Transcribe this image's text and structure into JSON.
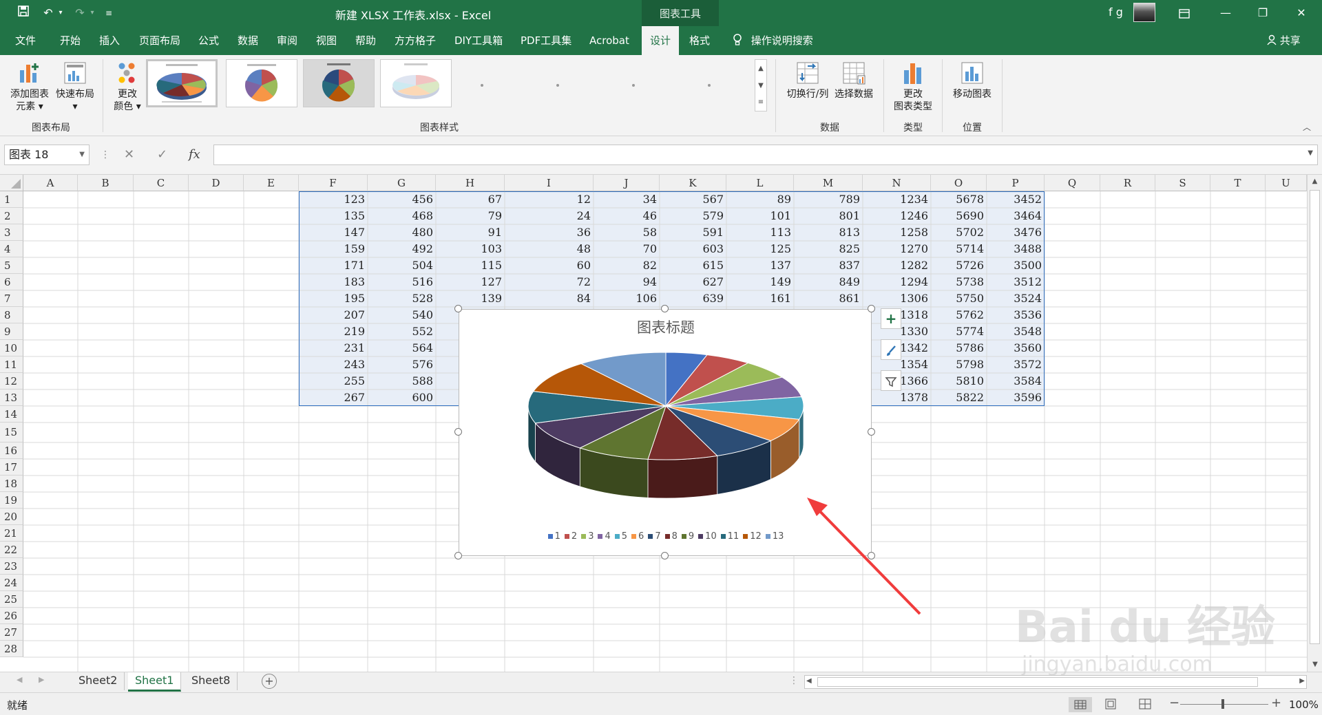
{
  "window": {
    "title": "新建 XLSX 工作表.xlsx  -  Excel",
    "context_tab_title": "图表工具",
    "user": "f g"
  },
  "menu": {
    "tabs": [
      "文件",
      "开始",
      "插入",
      "页面布局",
      "公式",
      "数据",
      "审阅",
      "视图",
      "帮助",
      "方方格子",
      "DIY工具箱",
      "PDF工具集",
      "Acrobat",
      "设计",
      "格式"
    ],
    "active_tab": "设计",
    "tell_me": "操作说明搜索",
    "share": "共享"
  },
  "ribbon": {
    "add_element": [
      "添加图表",
      "元素 ▾"
    ],
    "quick_layout": [
      "快速布局",
      "▾"
    ],
    "change_color": [
      "更改",
      "颜色 ▾"
    ],
    "switch_rowcol": "切换行/列",
    "select_data": "选择数据",
    "change_type": [
      "更改",
      "图表类型"
    ],
    "move_chart": "移动图表",
    "groups": {
      "layout": "图表布局",
      "styles": "图表样式",
      "data": "数据",
      "type": "类型",
      "location": "位置"
    }
  },
  "formula_bar": {
    "name_box": "图表 18",
    "fx": "fx",
    "value": ""
  },
  "sheet": {
    "columns": [
      "A",
      "B",
      "C",
      "D",
      "E",
      "F",
      "G",
      "H",
      "I",
      "J",
      "K",
      "L",
      "M",
      "N",
      "O",
      "P",
      "Q",
      "R",
      "S",
      "T",
      "U"
    ],
    "rows": [
      [
        "123",
        "456",
        "67",
        "12",
        "34",
        "567",
        "89",
        "789",
        "1234",
        "5678",
        "3452"
      ],
      [
        "135",
        "468",
        "79",
        "24",
        "46",
        "579",
        "101",
        "801",
        "1246",
        "5690",
        "3464"
      ],
      [
        "147",
        "480",
        "91",
        "36",
        "58",
        "591",
        "113",
        "813",
        "1258",
        "5702",
        "3476"
      ],
      [
        "159",
        "492",
        "103",
        "48",
        "70",
        "603",
        "125",
        "825",
        "1270",
        "5714",
        "3488"
      ],
      [
        "171",
        "504",
        "115",
        "60",
        "82",
        "615",
        "137",
        "837",
        "1282",
        "5726",
        "3500"
      ],
      [
        "183",
        "516",
        "127",
        "72",
        "94",
        "627",
        "149",
        "849",
        "1294",
        "5738",
        "3512"
      ],
      [
        "195",
        "528",
        "139",
        "84",
        "106",
        "639",
        "161",
        "861",
        "1306",
        "5750",
        "3524"
      ],
      [
        "207",
        "540",
        "",
        "",
        "",
        "",
        "",
        "",
        "1318",
        "5762",
        "3536"
      ],
      [
        "219",
        "552",
        "",
        "",
        "",
        "",
        "",
        "",
        "1330",
        "5774",
        "3548"
      ],
      [
        "231",
        "564",
        "",
        "",
        "",
        "",
        "",
        "",
        "1342",
        "5786",
        "3560"
      ],
      [
        "243",
        "576",
        "",
        "",
        "",
        "",
        "",
        "",
        "1354",
        "5798",
        "3572"
      ],
      [
        "255",
        "588",
        "",
        "",
        "",
        "",
        "",
        "",
        "1366",
        "5810",
        "3584"
      ],
      [
        "267",
        "600",
        "",
        "",
        "",
        "",
        "",
        "",
        "1378",
        "5822",
        "3596"
      ]
    ],
    "row_numbers": [
      "1",
      "2",
      "3",
      "4",
      "5",
      "6",
      "7",
      "8",
      "9",
      "10",
      "11",
      "12",
      "13",
      "14",
      "15",
      "16",
      "17",
      "18",
      "19",
      "20",
      "21",
      "22",
      "23",
      "24",
      "25",
      "26",
      "27",
      "28"
    ]
  },
  "chart_data": {
    "type": "pie",
    "title": "图表标题",
    "categories": [
      "1",
      "2",
      "3",
      "4",
      "5",
      "6",
      "7",
      "8",
      "9",
      "10",
      "11",
      "12",
      "13"
    ],
    "values": [
      123,
      135,
      147,
      159,
      171,
      183,
      195,
      207,
      219,
      231,
      243,
      255,
      267
    ],
    "colors": [
      "#4472c4",
      "#c0504d",
      "#9bbb59",
      "#8064a2",
      "#4bacc6",
      "#f79646",
      "#2c4d75",
      "#772c2a",
      "#5f7530",
      "#4d3b62",
      "#276a7c",
      "#b65708",
      "#729aca"
    ],
    "legend_position": "bottom"
  },
  "sheet_tabs": {
    "tabs": [
      "Sheet2",
      "Sheet1",
      "Sheet8"
    ],
    "active": "Sheet1"
  },
  "status": {
    "ready": "就绪",
    "zoom": "100%"
  },
  "watermark": {
    "brand": "Bai du 经验",
    "url": "jingyan.baidu.com"
  }
}
